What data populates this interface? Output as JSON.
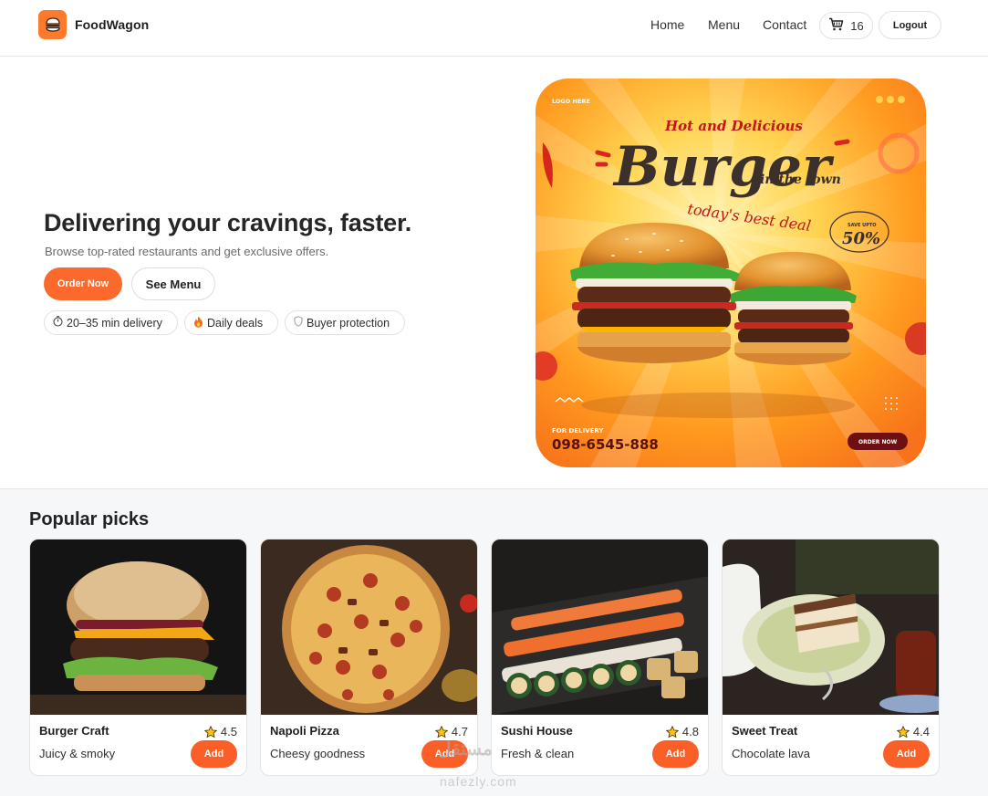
{
  "header": {
    "brand": "FoodWagon",
    "nav": [
      "Home",
      "Menu",
      "Contact"
    ],
    "cart_count": "16",
    "logout_label": "Logout"
  },
  "hero": {
    "title": "Delivering your cravings, faster.",
    "subtitle": "Browse top-rated restaurants and get exclusive offers.",
    "order_label": "Order Now",
    "menu_label": "See Menu",
    "chips": [
      {
        "icon": "timer-icon",
        "label": "20–35 min delivery"
      },
      {
        "icon": "fire-icon",
        "label": "Daily deals"
      },
      {
        "icon": "shield-icon",
        "label": "Buyer protection"
      }
    ],
    "poster": {
      "logo_text": "LOGO HERE",
      "tagline": "Hot and Delicious",
      "headline": "Burger",
      "sub_headline": "in the town",
      "deal": "today's best deal",
      "save_label": "SAVE UPTO",
      "save_value": "50%",
      "delivery_label": "FOR DELIVERY",
      "phone": "098-6545-888",
      "cta": "ORDER NOW"
    }
  },
  "popular": {
    "title": "Popular picks",
    "add_label": "Add",
    "items": [
      {
        "name": "Burger Craft",
        "desc": "Juicy & smoky",
        "rating": "4.5"
      },
      {
        "name": "Napoli Pizza",
        "desc": "Cheesy goodness",
        "rating": "4.7"
      },
      {
        "name": "Sushi House",
        "desc": "Fresh & clean",
        "rating": "4.8"
      },
      {
        "name": "Sweet Treat",
        "desc": "Chocolate lava",
        "rating": "4.4"
      }
    ]
  },
  "watermark": {
    "arabic": "مستقل",
    "latin": "nafezly.com"
  },
  "colors": {
    "accent": "#fb6a2c",
    "logo_bg": "#fb7a2b",
    "section_bg": "#f6f7f9"
  }
}
